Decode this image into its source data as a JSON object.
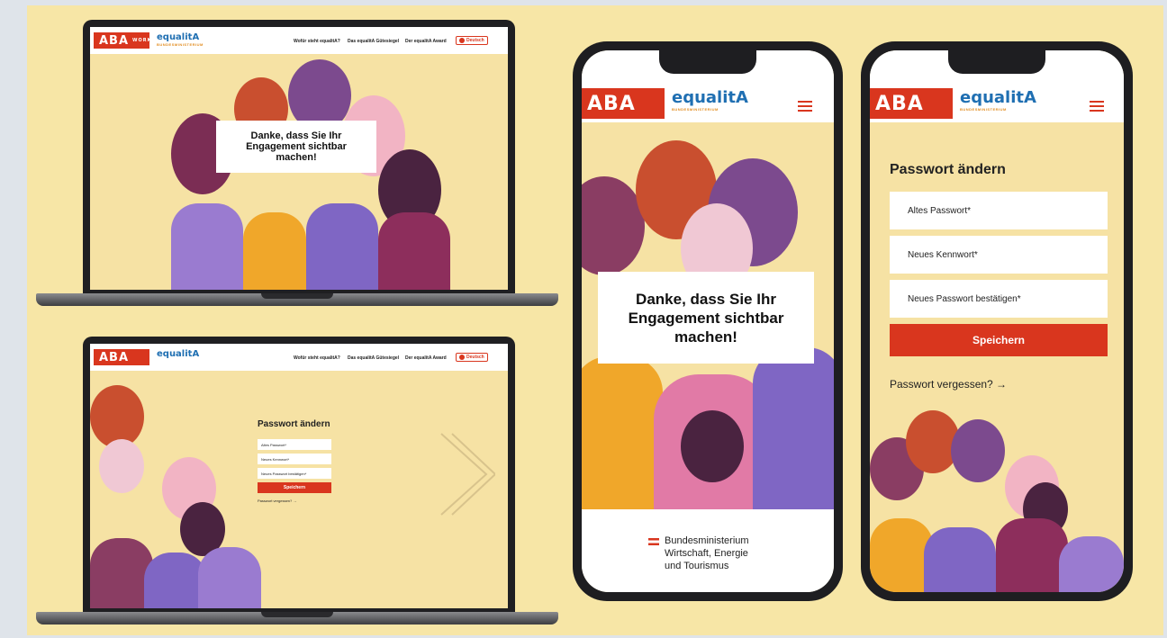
{
  "brand": {
    "aba": "ABA",
    "aba_sub": [
      "INVEST",
      "WORK",
      "FILM"
    ],
    "equalita": "equalitA",
    "equalita_sub": "BUNDESMINISTERIUM",
    "colors": {
      "red": "#d9361e",
      "blue": "#1f6fb2",
      "cream": "#f7e6a6"
    }
  },
  "nav": {
    "links": [
      "Wofür steht equalitA?",
      "Das equalitA Gütesiegel",
      "Der equalitA Award"
    ],
    "lang_label": "Deutsch",
    "menu_icon": "hamburger-icon"
  },
  "hero": {
    "message": "Danke, dass Sie Ihr Engagement sichtbar machen!"
  },
  "password_form": {
    "title": "Passwort ändern",
    "old_password": "Altes Passwort*",
    "new_password": "Neues Kennwort*",
    "confirm_password": "Neues Passwort bestätigen*",
    "save_label": "Speichern",
    "forgot_label": "Passwort vergessen? →"
  },
  "footer": {
    "ministry": [
      "Bundesministerium",
      "Wirtschaft, Energie",
      "und Tourismus"
    ]
  }
}
